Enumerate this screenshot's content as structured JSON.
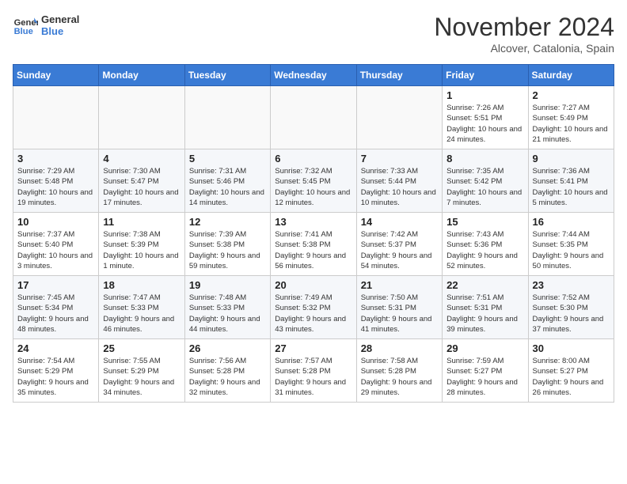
{
  "logo": {
    "general": "General",
    "blue": "Blue"
  },
  "title": "November 2024",
  "location": "Alcover, Catalonia, Spain",
  "weekdays": [
    "Sunday",
    "Monday",
    "Tuesday",
    "Wednesday",
    "Thursday",
    "Friday",
    "Saturday"
  ],
  "weeks": [
    [
      {
        "day": "",
        "info": ""
      },
      {
        "day": "",
        "info": ""
      },
      {
        "day": "",
        "info": ""
      },
      {
        "day": "",
        "info": ""
      },
      {
        "day": "",
        "info": ""
      },
      {
        "day": "1",
        "info": "Sunrise: 7:26 AM\nSunset: 5:51 PM\nDaylight: 10 hours and 24 minutes."
      },
      {
        "day": "2",
        "info": "Sunrise: 7:27 AM\nSunset: 5:49 PM\nDaylight: 10 hours and 21 minutes."
      }
    ],
    [
      {
        "day": "3",
        "info": "Sunrise: 7:29 AM\nSunset: 5:48 PM\nDaylight: 10 hours and 19 minutes."
      },
      {
        "day": "4",
        "info": "Sunrise: 7:30 AM\nSunset: 5:47 PM\nDaylight: 10 hours and 17 minutes."
      },
      {
        "day": "5",
        "info": "Sunrise: 7:31 AM\nSunset: 5:46 PM\nDaylight: 10 hours and 14 minutes."
      },
      {
        "day": "6",
        "info": "Sunrise: 7:32 AM\nSunset: 5:45 PM\nDaylight: 10 hours and 12 minutes."
      },
      {
        "day": "7",
        "info": "Sunrise: 7:33 AM\nSunset: 5:44 PM\nDaylight: 10 hours and 10 minutes."
      },
      {
        "day": "8",
        "info": "Sunrise: 7:35 AM\nSunset: 5:42 PM\nDaylight: 10 hours and 7 minutes."
      },
      {
        "day": "9",
        "info": "Sunrise: 7:36 AM\nSunset: 5:41 PM\nDaylight: 10 hours and 5 minutes."
      }
    ],
    [
      {
        "day": "10",
        "info": "Sunrise: 7:37 AM\nSunset: 5:40 PM\nDaylight: 10 hours and 3 minutes."
      },
      {
        "day": "11",
        "info": "Sunrise: 7:38 AM\nSunset: 5:39 PM\nDaylight: 10 hours and 1 minute."
      },
      {
        "day": "12",
        "info": "Sunrise: 7:39 AM\nSunset: 5:38 PM\nDaylight: 9 hours and 59 minutes."
      },
      {
        "day": "13",
        "info": "Sunrise: 7:41 AM\nSunset: 5:38 PM\nDaylight: 9 hours and 56 minutes."
      },
      {
        "day": "14",
        "info": "Sunrise: 7:42 AM\nSunset: 5:37 PM\nDaylight: 9 hours and 54 minutes."
      },
      {
        "day": "15",
        "info": "Sunrise: 7:43 AM\nSunset: 5:36 PM\nDaylight: 9 hours and 52 minutes."
      },
      {
        "day": "16",
        "info": "Sunrise: 7:44 AM\nSunset: 5:35 PM\nDaylight: 9 hours and 50 minutes."
      }
    ],
    [
      {
        "day": "17",
        "info": "Sunrise: 7:45 AM\nSunset: 5:34 PM\nDaylight: 9 hours and 48 minutes."
      },
      {
        "day": "18",
        "info": "Sunrise: 7:47 AM\nSunset: 5:33 PM\nDaylight: 9 hours and 46 minutes."
      },
      {
        "day": "19",
        "info": "Sunrise: 7:48 AM\nSunset: 5:33 PM\nDaylight: 9 hours and 44 minutes."
      },
      {
        "day": "20",
        "info": "Sunrise: 7:49 AM\nSunset: 5:32 PM\nDaylight: 9 hours and 43 minutes."
      },
      {
        "day": "21",
        "info": "Sunrise: 7:50 AM\nSunset: 5:31 PM\nDaylight: 9 hours and 41 minutes."
      },
      {
        "day": "22",
        "info": "Sunrise: 7:51 AM\nSunset: 5:31 PM\nDaylight: 9 hours and 39 minutes."
      },
      {
        "day": "23",
        "info": "Sunrise: 7:52 AM\nSunset: 5:30 PM\nDaylight: 9 hours and 37 minutes."
      }
    ],
    [
      {
        "day": "24",
        "info": "Sunrise: 7:54 AM\nSunset: 5:29 PM\nDaylight: 9 hours and 35 minutes."
      },
      {
        "day": "25",
        "info": "Sunrise: 7:55 AM\nSunset: 5:29 PM\nDaylight: 9 hours and 34 minutes."
      },
      {
        "day": "26",
        "info": "Sunrise: 7:56 AM\nSunset: 5:28 PM\nDaylight: 9 hours and 32 minutes."
      },
      {
        "day": "27",
        "info": "Sunrise: 7:57 AM\nSunset: 5:28 PM\nDaylight: 9 hours and 31 minutes."
      },
      {
        "day": "28",
        "info": "Sunrise: 7:58 AM\nSunset: 5:28 PM\nDaylight: 9 hours and 29 minutes."
      },
      {
        "day": "29",
        "info": "Sunrise: 7:59 AM\nSunset: 5:27 PM\nDaylight: 9 hours and 28 minutes."
      },
      {
        "day": "30",
        "info": "Sunrise: 8:00 AM\nSunset: 5:27 PM\nDaylight: 9 hours and 26 minutes."
      }
    ]
  ]
}
